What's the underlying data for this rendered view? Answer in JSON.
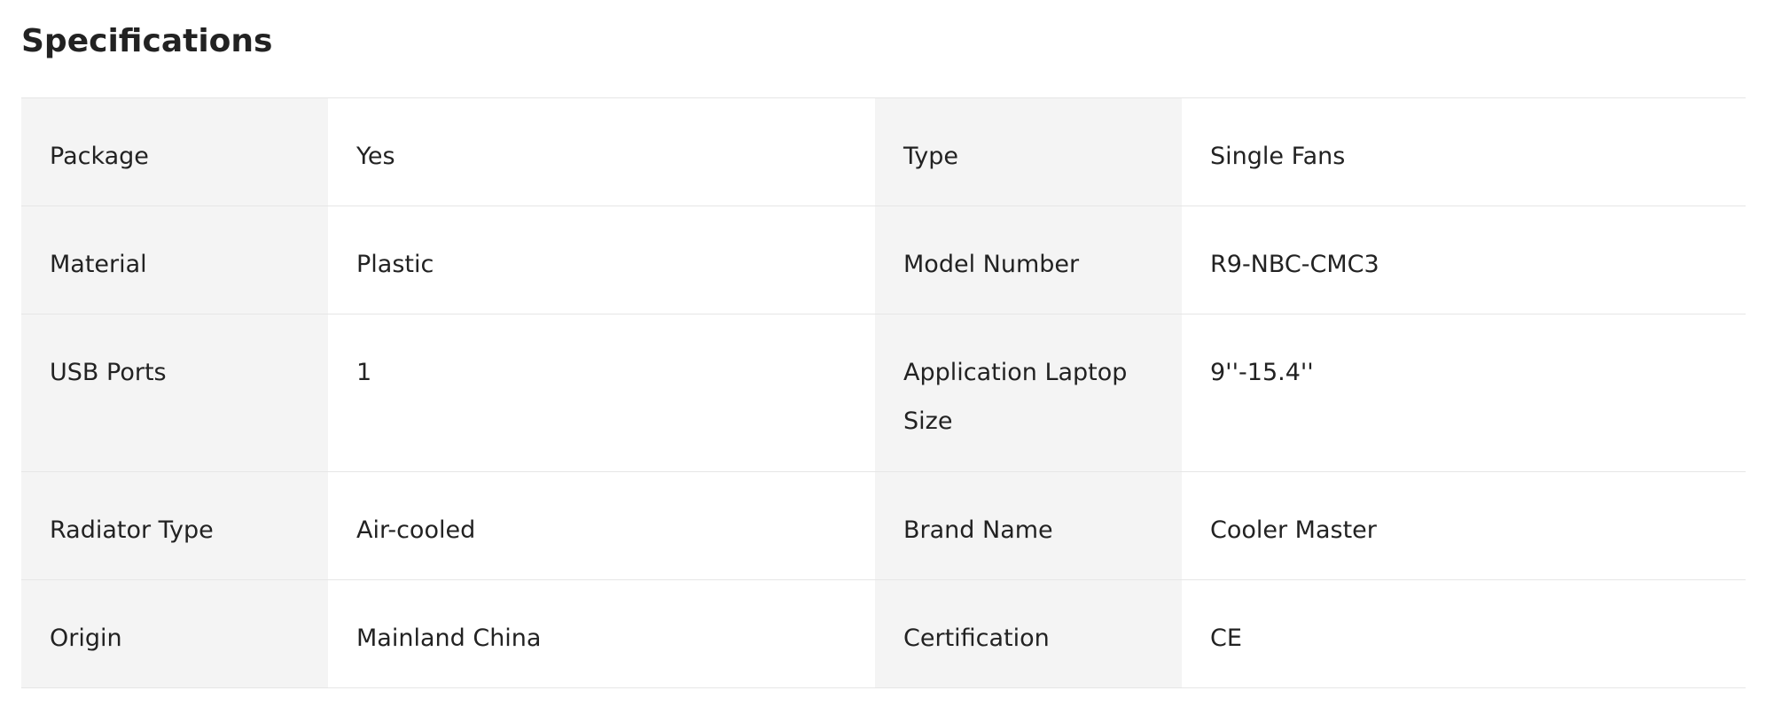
{
  "title": "Specifications",
  "specs": [
    {
      "left_key": "Package",
      "left_value": "Yes",
      "right_key": "Type",
      "right_value": "Single Fans"
    },
    {
      "left_key": "Material",
      "left_value": "Plastic",
      "right_key": "Model Number",
      "right_value": "R9-NBC-CMC3"
    },
    {
      "left_key": "USB Ports",
      "left_value": "1",
      "right_key": "Application Laptop Size",
      "right_value": "9''-15.4''"
    },
    {
      "left_key": "Radiator Type",
      "left_value": "Air-cooled",
      "right_key": "Brand Name",
      "right_value": "Cooler Master"
    },
    {
      "left_key": "Origin",
      "left_value": "Mainland China",
      "right_key": "Certification",
      "right_value": "CE"
    }
  ]
}
